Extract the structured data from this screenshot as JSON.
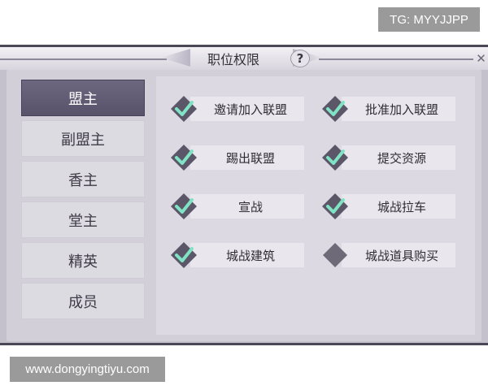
{
  "watermarks": {
    "top": "TG: MYYJJPP",
    "bottom": "www.dongyingtiyu.com"
  },
  "dialog": {
    "title": "职位权限",
    "help_label": "?",
    "close_label": "✕"
  },
  "sidebar": {
    "items": [
      {
        "label": "盟主",
        "active": true
      },
      {
        "label": "副盟主",
        "active": false
      },
      {
        "label": "香主",
        "active": false
      },
      {
        "label": "堂主",
        "active": false
      },
      {
        "label": "精英",
        "active": false
      },
      {
        "label": "成员",
        "active": false
      }
    ]
  },
  "permissions": [
    {
      "label": "邀请加入联盟",
      "checked": true
    },
    {
      "label": "批准加入联盟",
      "checked": true
    },
    {
      "label": "踢出联盟",
      "checked": true
    },
    {
      "label": "提交资源",
      "checked": true
    },
    {
      "label": "宣战",
      "checked": true
    },
    {
      "label": "城战拉车",
      "checked": true
    },
    {
      "label": "城战建筑",
      "checked": true
    },
    {
      "label": "城战道具购买",
      "checked": false
    }
  ],
  "colors": {
    "check_mark": "#7fe3c4",
    "diamond": "#6e6a78",
    "active_tab": "#5f5a72"
  }
}
